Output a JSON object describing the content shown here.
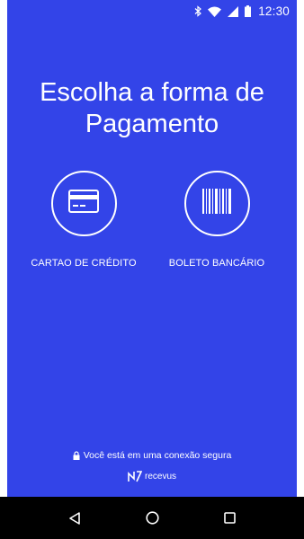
{
  "status_bar": {
    "time": "12:30",
    "icons": [
      "bluetooth-icon",
      "wifi-icon",
      "signal-icon",
      "battery-icon"
    ]
  },
  "title": {
    "line1": "Escolha a forma de",
    "line2": "Pagamento"
  },
  "options": [
    {
      "label": "CARTAO DE CRÉDITO",
      "icon": "credit-card-icon"
    },
    {
      "label": "BOLETO BANCÁRIO",
      "icon": "barcode-icon"
    }
  ],
  "footer": {
    "secure_text": "Você está em uma conexão segura",
    "brand": "recevus"
  },
  "nav": [
    "back-icon",
    "home-icon",
    "recents-icon"
  ],
  "colors": {
    "background": "#3344e8",
    "foreground": "#ffffff",
    "navbar": "#000000"
  }
}
